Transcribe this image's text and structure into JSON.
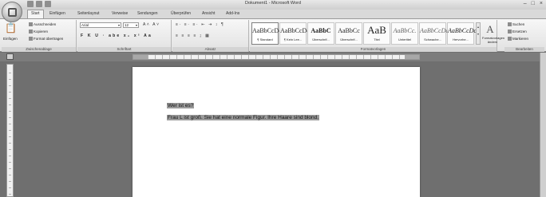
{
  "window": {
    "title": "Dokument1 - Microsoft Word",
    "controls": [
      "–",
      "□",
      "×"
    ]
  },
  "tabs": [
    "Start",
    "Einfügen",
    "Seitenlayout",
    "Verweise",
    "Sendungen",
    "Überprüfen",
    "Ansicht",
    "Add-Ins"
  ],
  "ribbon": {
    "clipboard": {
      "paste_label": "Einfügen",
      "cut_label": "Ausschneiden",
      "copy_label": "Kopieren",
      "format_painter_label": "Format übertragen",
      "group_label": "Zwischenablage"
    },
    "font": {
      "font_name": "Arial",
      "font_size": "12",
      "format_buttons": "F K U · abe x₂ x² Aa",
      "grow_shrink": "A˄ A˅",
      "group_label": "Schriftart"
    },
    "paragraph": {
      "list_buttons": "≡· ≡· ≡· ⇤ ⇥ ↕ ¶",
      "align_buttons": "≡ ≡ ≡ ≡ ↨ ▦",
      "group_label": "Absatz"
    },
    "styles": {
      "items": [
        {
          "sample": "AaBbCcDc",
          "name": "¶ Standard"
        },
        {
          "sample": "AaBbCcDc",
          "name": "¶ Kein Lee..."
        },
        {
          "sample": "AaBbC",
          "name": "Überschrif..."
        },
        {
          "sample": "AaBbCc",
          "name": "Überschrif..."
        },
        {
          "sample": "AaB",
          "name": "Titel"
        },
        {
          "sample": "AaBbCc.",
          "name": "Untertitel"
        },
        {
          "sample": "AaBbCcDc",
          "name": "Schwache..."
        },
        {
          "sample": "AaBbCcDc",
          "name": "Hervorhe..."
        }
      ],
      "change_styles_label": "Formatvorlagen ändern",
      "group_label": "Formatvorlagen"
    },
    "editing": {
      "find_label": "Suchen",
      "replace_label": "Ersetzen",
      "select_label": "Markieren",
      "group_label": "Bearbeiten"
    }
  },
  "document": {
    "lines": [
      "Wer ist es?",
      "Frau L ist groß. Sie hat eine normale Figur. Ihre Haare sind blond."
    ]
  }
}
